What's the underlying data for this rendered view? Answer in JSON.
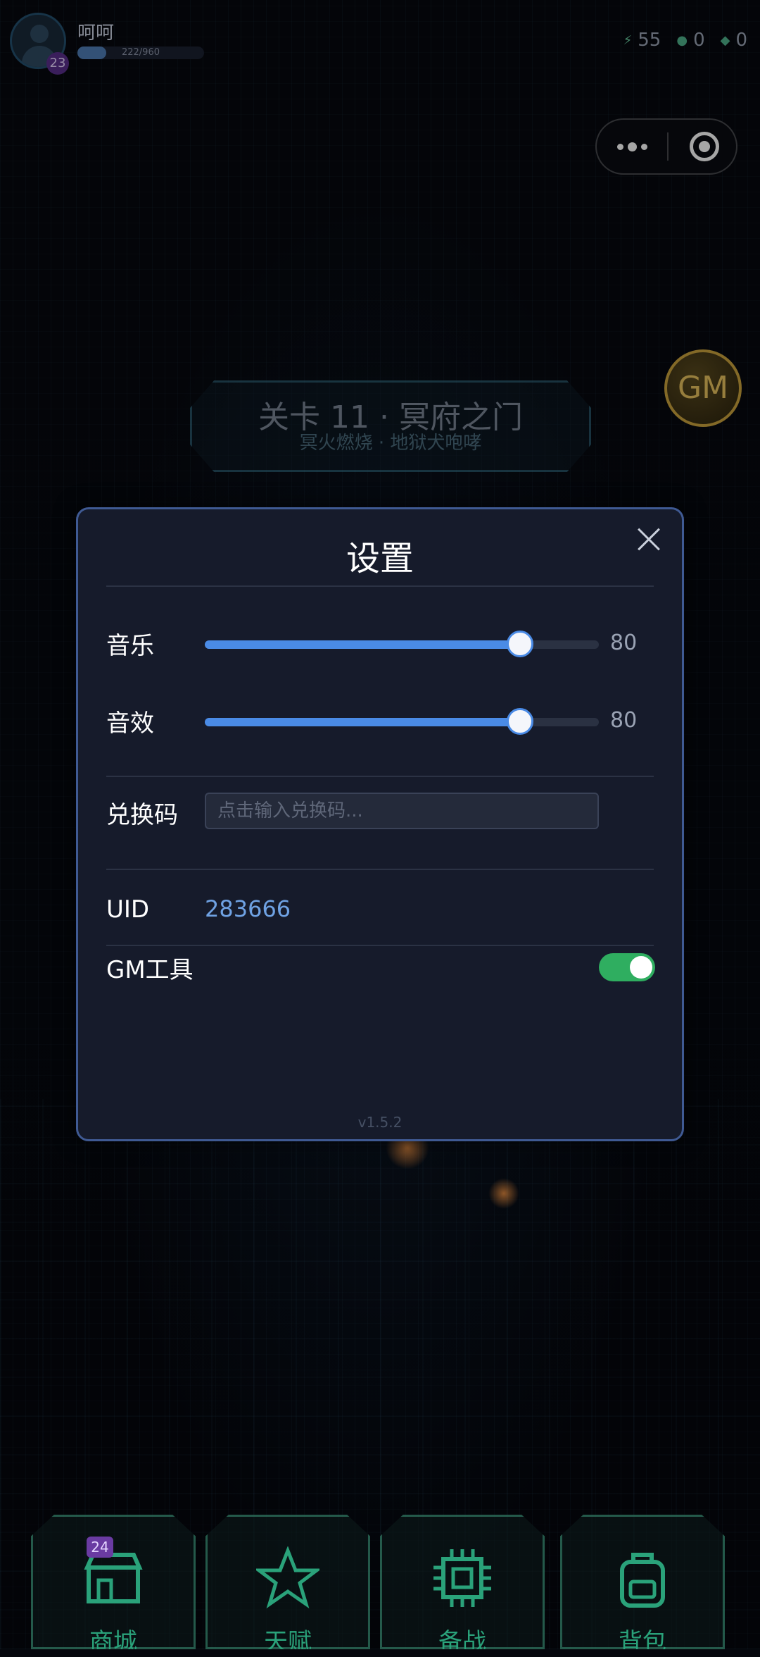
{
  "player": {
    "name": "呵呵",
    "level": "23",
    "xp_text": "222/960",
    "xp_fraction": 0.23
  },
  "stats": {
    "energy": "55",
    "coins": "0",
    "gems": "0"
  },
  "gm_button": "GM",
  "level_banner": {
    "title": "关卡 11 · 冥府之门",
    "subtitle": "冥火燃烧 · 地狱犬咆哮"
  },
  "settings": {
    "title": "设置",
    "music_label": "音乐",
    "music_value": 80,
    "sfx_label": "音效",
    "sfx_value": 80,
    "redeem_label": "兑换码",
    "redeem_placeholder": "点击输入兑换码...",
    "redeem_value": "",
    "uid_label": "UID",
    "uid_value": "283666",
    "gm_tool_label": "GM工具",
    "gm_tool_enabled": true,
    "version": "v1.5.2"
  },
  "bottom_nav": [
    {
      "label": "商城",
      "badge": "24",
      "icon": "shop-icon"
    },
    {
      "label": "天赋",
      "icon": "star-icon"
    },
    {
      "label": "备战",
      "icon": "chip-icon"
    },
    {
      "label": "背包",
      "icon": "backpack-icon"
    }
  ],
  "colors": {
    "accent_blue": "#4a8be6",
    "toggle_green": "#2fae60",
    "gm_gold": "#c9a13d",
    "nav_green": "#2aa27a"
  }
}
